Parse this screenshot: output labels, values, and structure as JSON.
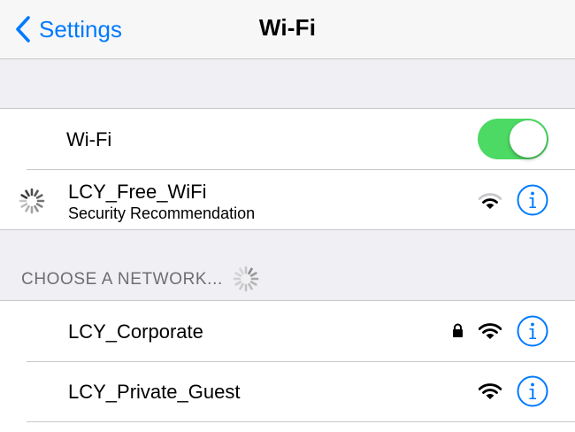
{
  "navbar": {
    "back_label": "Settings",
    "title": "Wi-Fi"
  },
  "wifi_toggle": {
    "label": "Wi-Fi",
    "on": true
  },
  "current_network": {
    "name": "LCY_Free_WiFi",
    "subtitle": "Security Recommendation",
    "status": "connecting"
  },
  "networks_header": "CHOOSE A NETWORK...",
  "networks": [
    {
      "name": "LCY_Corporate",
      "secured": true
    },
    {
      "name": "LCY_Private_Guest",
      "secured": false
    }
  ],
  "colors": {
    "accent": "#007aff",
    "toggle_on": "#4cd964",
    "background": "#efeff4",
    "header_text": "#6d6d72"
  },
  "icons": {
    "back": "chevron-left-icon",
    "wifi": "wifi-signal-icon",
    "info": "info-icon",
    "lock": "lock-icon",
    "spinner": "activity-spinner-icon"
  }
}
